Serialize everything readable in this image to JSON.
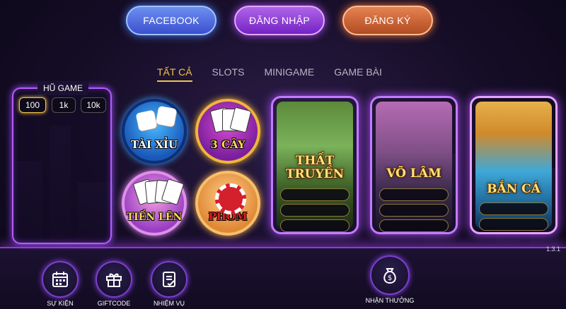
{
  "header": {
    "facebook_label": "FACEBOOK",
    "login_label": "ĐĂNG NHẬP",
    "register_label": "ĐĂNG KÝ"
  },
  "tabs": [
    {
      "label": "TẤT CẢ",
      "active": true
    },
    {
      "label": "SLOTS",
      "active": false
    },
    {
      "label": "MINIGAME",
      "active": false
    },
    {
      "label": "GAME BÀI",
      "active": false
    }
  ],
  "jackpot": {
    "title": "HŨ GAME",
    "options": [
      "100",
      "1k",
      "10k"
    ],
    "selected": "100"
  },
  "round_games": [
    {
      "name": "TÀI XỈU"
    },
    {
      "name": "3 CÂY"
    },
    {
      "name": "TIẾN LÊN"
    },
    {
      "name": "PHỎM"
    }
  ],
  "slot_games": [
    {
      "name_line1": "THẤT",
      "name_line2": "TRUYỀN"
    },
    {
      "name_line1": "VÕ LÂM",
      "name_line2": ""
    },
    {
      "name_line1": "BẮN CÁ",
      "name_line2": ""
    }
  ],
  "version": "1.3.1",
  "bottom_menu": [
    {
      "label": "SỰ KIỆN",
      "icon": "calendar-icon"
    },
    {
      "label": "GIFTCODE",
      "icon": "gift-icon"
    },
    {
      "label": "NHIỆM VỤ",
      "icon": "checklist-icon"
    },
    {
      "label": "NHẬN THƯỞNG",
      "icon": "money-bag-icon"
    }
  ],
  "colors": {
    "accent_purple": "#b35cff",
    "tab_active": "#f4c34a",
    "facebook_blue": "#3b4fd0",
    "login_purple": "#7322c4",
    "register_orange": "#b24b22"
  }
}
